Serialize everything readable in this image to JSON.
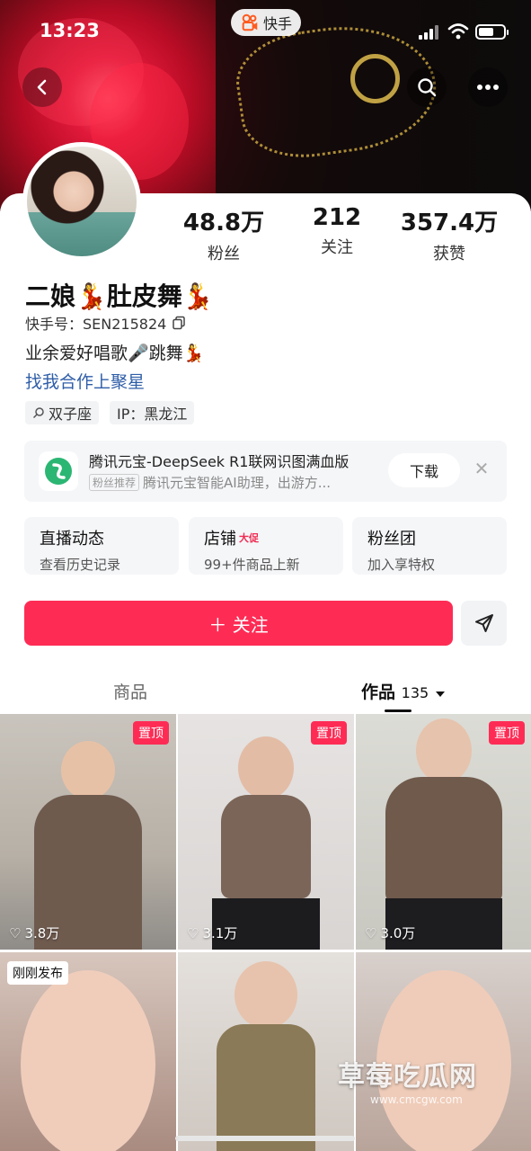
{
  "status_bar": {
    "time": "13:23",
    "app_badge": "快手"
  },
  "header": {
    "back_icon": "chevron-left-icon",
    "search_icon": "search-icon",
    "more_icon": "more-horizontal-icon"
  },
  "profile": {
    "stats": [
      {
        "value": "48.8万",
        "label": "粉丝"
      },
      {
        "value": "212",
        "label": "关注"
      },
      {
        "value": "357.4万",
        "label": "获赞"
      }
    ],
    "name": "二娘💃肚皮舞💃",
    "kuaishou_id": "快手号：SEN215824",
    "bio": "业余爱好唱歌🎤跳舞💃",
    "bio_link": "找我合作上聚星",
    "tags": [
      "双子座",
      "IP：黑龙江"
    ]
  },
  "ad": {
    "title": "腾讯元宝-DeepSeek R1联网识图满血版",
    "chip": "粉丝推荐",
    "subtitle": "腾讯元宝智能AI助理，出游方...",
    "download_label": "下载"
  },
  "features": [
    {
      "title": "直播动态",
      "promo": "",
      "subtitle": "查看历史记录"
    },
    {
      "title": "店铺",
      "promo": "大促",
      "subtitle": "99+件商品上新"
    },
    {
      "title": "粉丝团",
      "promo": "",
      "subtitle": "加入享特权"
    }
  ],
  "actions": {
    "follow_label": "＋ 关注"
  },
  "tabs": [
    {
      "label": "商品",
      "count": ""
    },
    {
      "label": "作品",
      "count": "135"
    }
  ],
  "videos": [
    {
      "badge": "置顶",
      "likes": "3.8万"
    },
    {
      "badge": "置顶",
      "likes": "3.1万"
    },
    {
      "badge": "置顶",
      "likes": "3.0万"
    },
    {
      "badge": "刚刚发布",
      "likes": ""
    },
    {
      "badge": "",
      "likes": ""
    },
    {
      "badge": "",
      "likes": ""
    }
  ],
  "watermark": {
    "title": "草莓吃瓜网",
    "url": "www.cmcgw.com"
  },
  "colors": {
    "accent": "#fe2c55",
    "link": "#2f5ea8"
  }
}
